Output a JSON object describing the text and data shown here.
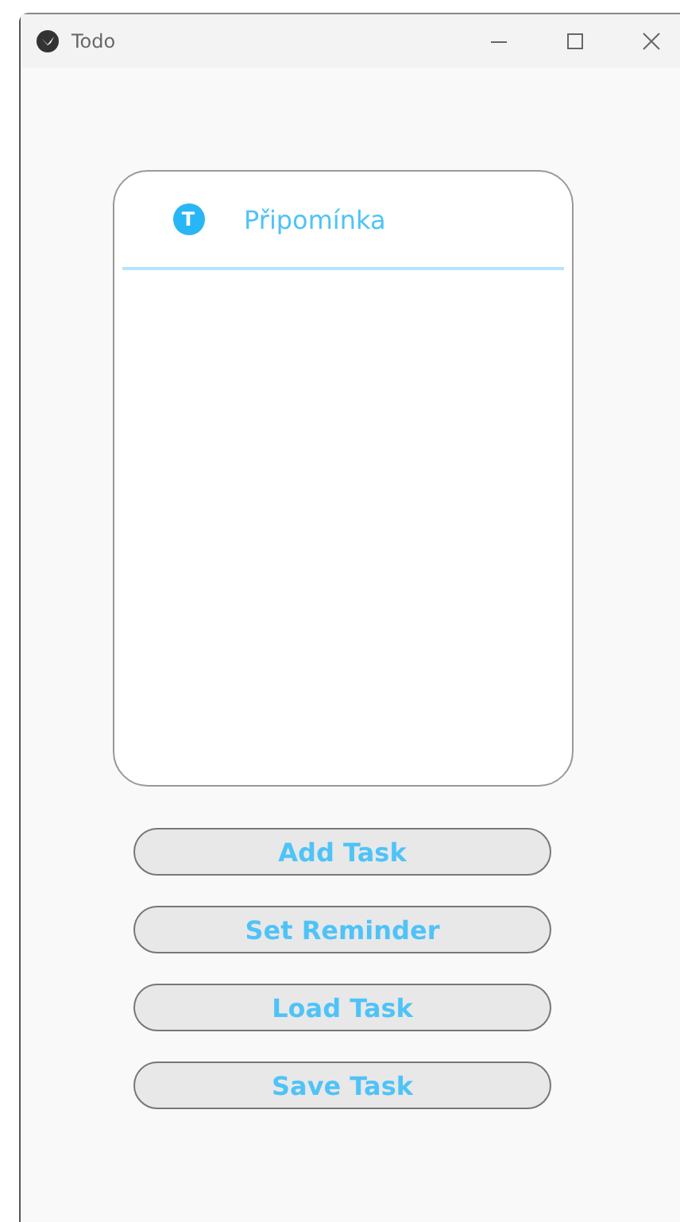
{
  "window": {
    "title": "Todo"
  },
  "tasks": [
    {
      "initial": "T",
      "text": "Připomínka"
    }
  ],
  "buttons": [
    "Add Task",
    "Set Reminder",
    "Load Task",
    "Save Task"
  ]
}
